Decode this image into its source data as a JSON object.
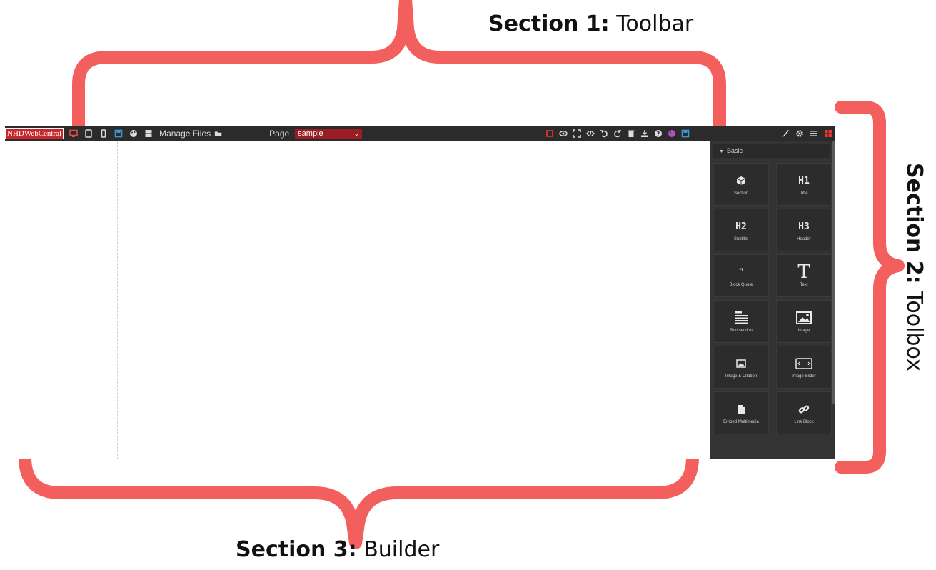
{
  "annotations": {
    "section1": {
      "bold": "Section 1:",
      "text": "Toolbar"
    },
    "section2": {
      "bold": "Section 2:",
      "text": "Toolbox"
    },
    "section3": {
      "bold": "Section 3:",
      "text": "Builder"
    },
    "brace_color": "#f25f5c"
  },
  "toolbar": {
    "logo": "NHDWebCentral",
    "manage_files_label": "Manage Files",
    "page_label": "Page",
    "page_select_value": "sample",
    "left_icons": [
      "desktop-icon",
      "tablet-icon",
      "mobile-icon",
      "save-icon",
      "palette-icon",
      "database-icon",
      "folder-icon"
    ],
    "right_icons": [
      "square-outline-icon",
      "eye-icon",
      "fullscreen-icon",
      "code-icon",
      "undo-icon",
      "redo-icon",
      "trash-icon",
      "import-icon",
      "help-icon",
      "palette-icon",
      "save-icon"
    ],
    "panel_icons": [
      "brush-icon",
      "gear-icon",
      "layers-icon",
      "blocks-icon"
    ]
  },
  "toolbox": {
    "category": "Basic",
    "blocks": [
      {
        "label": "Section",
        "icon": "cube-icon",
        "glyph": "⬢"
      },
      {
        "label": "Title",
        "icon": "h1-icon",
        "glyph": "H1"
      },
      {
        "label": "Subtitle",
        "icon": "h2-icon",
        "glyph": "H2"
      },
      {
        "label": "Header",
        "icon": "h3-icon",
        "glyph": "H3"
      },
      {
        "label": "Block Quote",
        "icon": "quote-icon",
        "glyph": "❞"
      },
      {
        "label": "Text",
        "icon": "text-icon",
        "glyph": "T"
      },
      {
        "label": "Text section",
        "icon": "text-section-icon",
        "glyph": "☰"
      },
      {
        "label": "Image",
        "icon": "image-icon",
        "glyph": ""
      },
      {
        "label": "Image & Citation",
        "icon": "image-citation-icon",
        "glyph": ""
      },
      {
        "label": "Image Slider",
        "icon": "image-slider-icon",
        "glyph": ""
      },
      {
        "label": "Embed Multimedia",
        "icon": "file-icon",
        "glyph": ""
      },
      {
        "label": "Link Block",
        "icon": "link-icon",
        "glyph": ""
      }
    ]
  }
}
